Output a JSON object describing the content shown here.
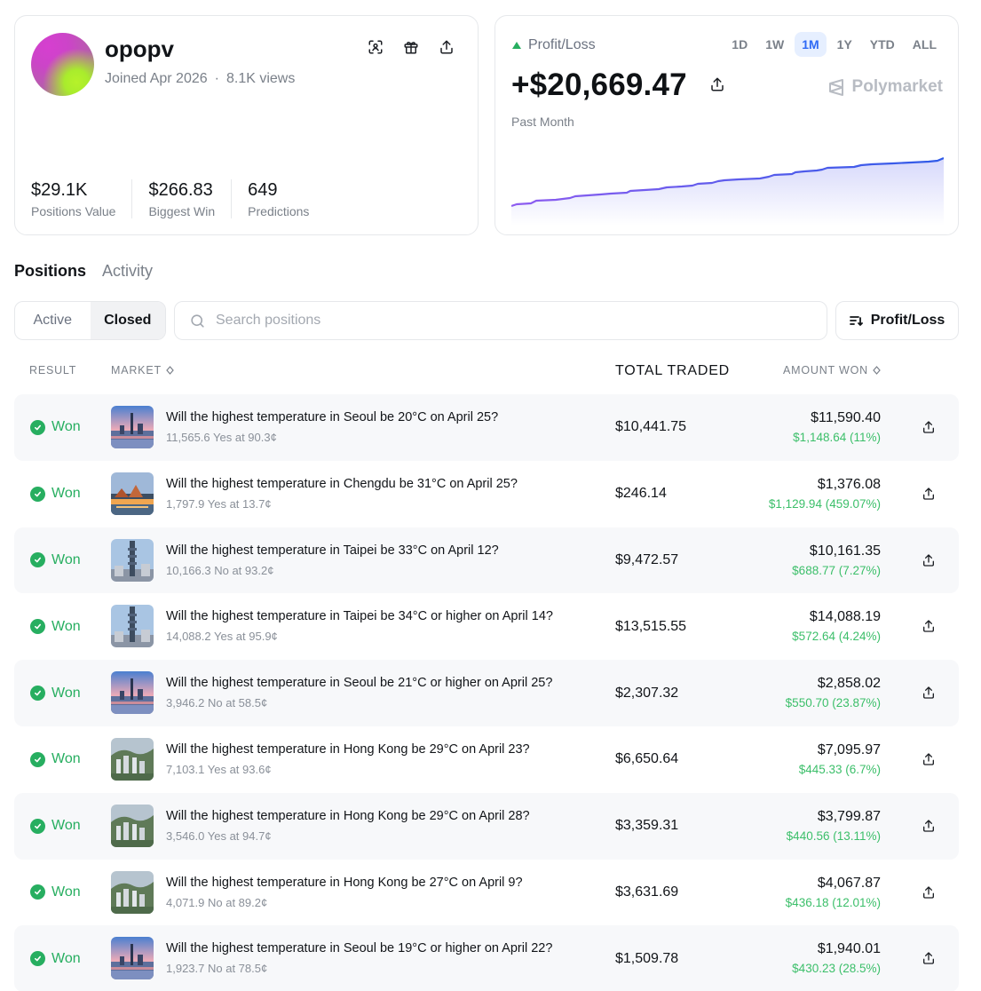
{
  "profile": {
    "username": "opopv",
    "joined": "Joined Apr 2026",
    "views": "8.1K views",
    "stats": [
      {
        "value": "$29.1K",
        "label": "Positions Value"
      },
      {
        "value": "$266.83",
        "label": "Biggest Win"
      },
      {
        "value": "649",
        "label": "Predictions"
      }
    ],
    "icons": [
      "scan-icon",
      "gift-icon",
      "share-icon"
    ]
  },
  "pnl": {
    "label": "Profit/Loss",
    "value": "+$20,669.47",
    "period": "Past Month",
    "brand": "Polymarket",
    "ranges": [
      "1D",
      "1W",
      "1M",
      "1Y",
      "YTD",
      "ALL"
    ],
    "active_range": "1M",
    "colors": {
      "up": "#27ae60",
      "line_start": "#8e5cf0",
      "line_end": "#2f5be8",
      "active_range_bg": "#e6efff"
    }
  },
  "tabs": {
    "positions": "Positions",
    "activity": "Activity"
  },
  "filter": {
    "active": "Active",
    "closed": "Closed",
    "search_placeholder": "Search positions",
    "sort_label": "Profit/Loss"
  },
  "table": {
    "headers": {
      "result": "RESULT",
      "market": "MARKET",
      "traded": "TOTAL TRADED",
      "won": "AMOUNT WON"
    },
    "rows": [
      {
        "result": "Won",
        "city": "seoul",
        "title": "Will the highest temperature in Seoul be 20°C on April 25?",
        "sub": "11,565.6 Yes at 90.3¢",
        "traded": "$10,441.75",
        "amount": "$11,590.40",
        "gain": "$1,148.64 (11%)"
      },
      {
        "result": "Won",
        "city": "chengdu",
        "title": "Will the highest temperature in Chengdu be 31°C on April 25?",
        "sub": "1,797.9 Yes at 13.7¢",
        "traded": "$246.14",
        "amount": "$1,376.08",
        "gain": "$1,129.94 (459.07%)"
      },
      {
        "result": "Won",
        "city": "taipei",
        "title": "Will the highest temperature in Taipei be 33°C on April 12?",
        "sub": "10,166.3 No at 93.2¢",
        "traded": "$9,472.57",
        "amount": "$10,161.35",
        "gain": "$688.77 (7.27%)"
      },
      {
        "result": "Won",
        "city": "taipei",
        "title": "Will the highest temperature in Taipei be 34°C or higher on April 14?",
        "sub": "14,088.2 Yes at 95.9¢",
        "traded": "$13,515.55",
        "amount": "$14,088.19",
        "gain": "$572.64 (4.24%)"
      },
      {
        "result": "Won",
        "city": "seoul",
        "title": "Will the highest temperature in Seoul be 21°C or higher on April 25?",
        "sub": "3,946.2 No at 58.5¢",
        "traded": "$2,307.32",
        "amount": "$2,858.02",
        "gain": "$550.70 (23.87%)"
      },
      {
        "result": "Won",
        "city": "hongkong",
        "title": "Will the highest temperature in Hong Kong be 29°C on April 23?",
        "sub": "7,103.1 Yes at 93.6¢",
        "traded": "$6,650.64",
        "amount": "$7,095.97",
        "gain": "$445.33 (6.7%)"
      },
      {
        "result": "Won",
        "city": "hongkong",
        "title": "Will the highest temperature in Hong Kong be 29°C on April 28?",
        "sub": "3,546.0 Yes at 94.7¢",
        "traded": "$3,359.31",
        "amount": "$3,799.87",
        "gain": "$440.56 (13.11%)"
      },
      {
        "result": "Won",
        "city": "hongkong",
        "title": "Will the highest temperature in Hong Kong be 27°C on April 9?",
        "sub": "4,071.9 No at 89.2¢",
        "traded": "$3,631.69",
        "amount": "$4,067.87",
        "gain": "$436.18 (12.01%)"
      },
      {
        "result": "Won",
        "city": "seoul",
        "title": "Will the highest temperature in Seoul be 19°C or higher on April 22?",
        "sub": "1,923.7 No at 78.5¢",
        "traded": "$1,509.78",
        "amount": "$1,940.01",
        "gain": "$430.23 (28.5%)"
      }
    ]
  }
}
